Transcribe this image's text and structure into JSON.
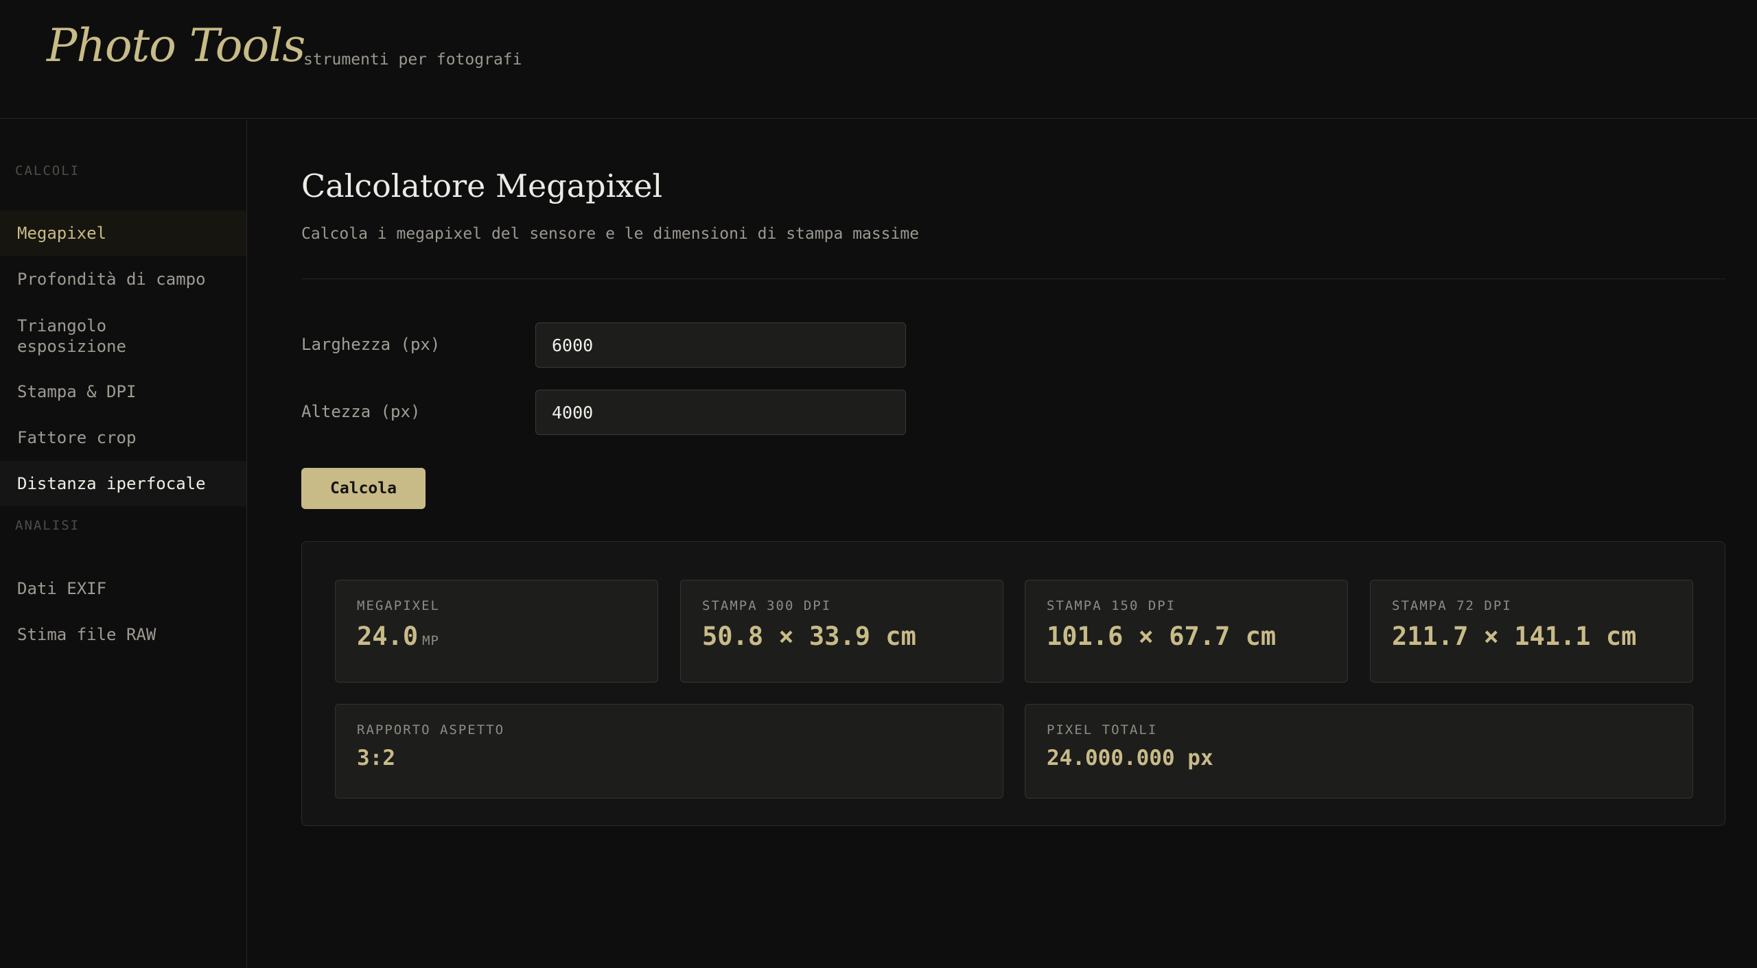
{
  "header": {
    "logo": "Photo Tools",
    "tagline": "strumenti per fotografi"
  },
  "sidebar": {
    "sections": [
      {
        "label": "CALCOLI",
        "items": [
          {
            "label": "Megapixel",
            "state": "active"
          },
          {
            "label": "Profondità di campo"
          },
          {
            "label": "Triangolo esposizione"
          },
          {
            "label": "Stampa & DPI"
          },
          {
            "label": "Fattore crop"
          },
          {
            "label": "Distanza iperfocale",
            "state": "hover"
          }
        ]
      },
      {
        "label": "ANALISI",
        "items": [
          {
            "label": "Dati EXIF"
          },
          {
            "label": "Stima file RAW"
          }
        ]
      }
    ]
  },
  "main": {
    "title": "Calcolatore Megapixel",
    "subtitle": "Calcola i megapixel del sensore e le dimensioni di stampa massime",
    "fields": [
      {
        "label": "Larghezza (px)",
        "value": "6000"
      },
      {
        "label": "Altezza (px)",
        "value": "4000"
      }
    ],
    "button_label": "Calcola",
    "results": {
      "megapixel": {
        "label": "MEGAPIXEL",
        "value": "24.0",
        "unit": "MP"
      },
      "print_300": {
        "label": "STAMPA 300 DPI",
        "value": "50.8 × 33.9 cm"
      },
      "print_150": {
        "label": "STAMPA 150 DPI",
        "value": "101.6 × 67.7 cm"
      },
      "print_72": {
        "label": "STAMPA 72 DPI",
        "value": "211.7 × 141.1 cm"
      },
      "aspect": {
        "label": "RAPPORTO ASPETTO",
        "value": "3:2"
      },
      "total": {
        "label": "PIXEL TOTALI",
        "value": "24.000.000 px"
      }
    }
  },
  "colors": {
    "background": "#0e0e0e",
    "accent": "#c8bb87",
    "panel": "#141414",
    "card": "#1d1d1c"
  }
}
